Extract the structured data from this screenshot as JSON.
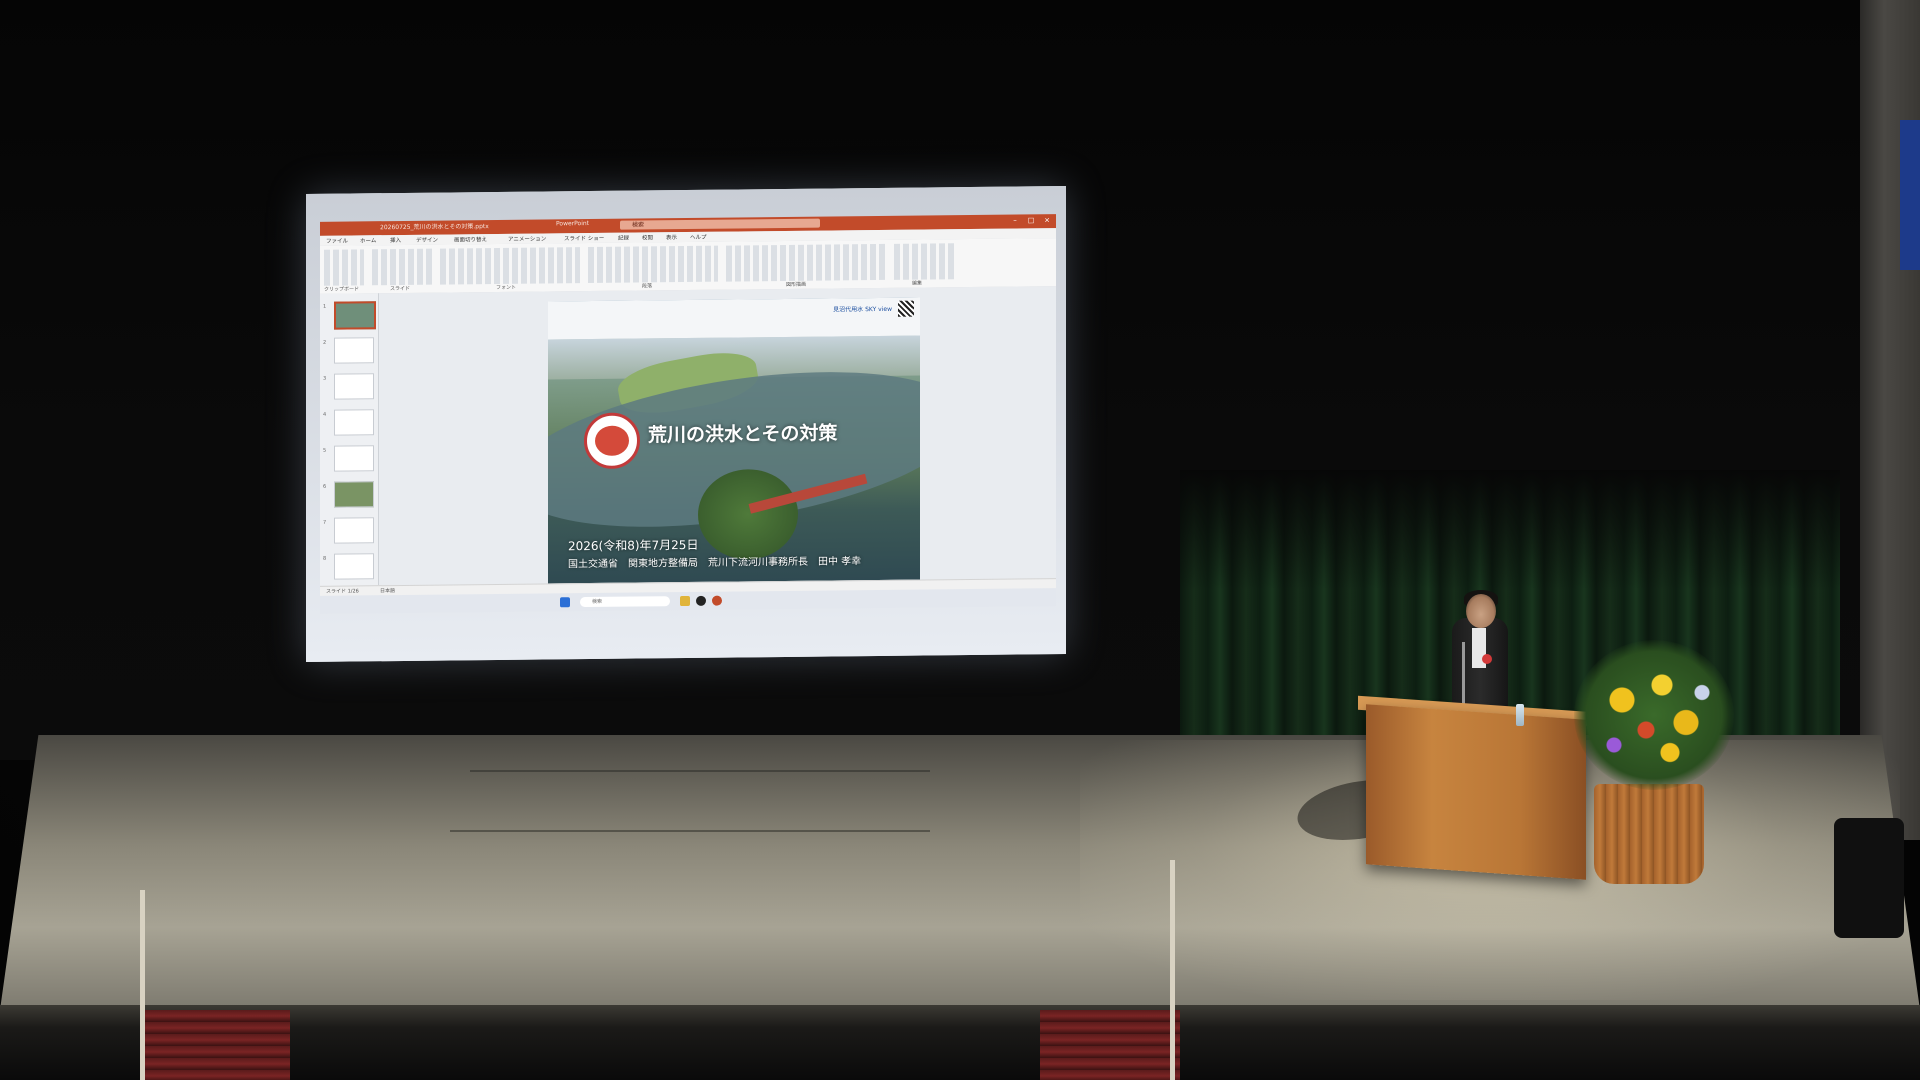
{
  "slide_topbar_text": "見沼代用水 SKY view",
  "slide_title": "荒川の洪水とその対策",
  "slide_date": "2026(令和8)年7月25日",
  "slide_author": "国土交通省　関東地方整備局　荒川下流河川事務所長　田中 孝幸",
  "ppt": {
    "window_title": "20260725_荒川の洪水とその対策.pptx",
    "app_name": "PowerPoint",
    "search_placeholder": "検索",
    "tabs": [
      "ファイル",
      "ホーム",
      "挿入",
      "デザイン",
      "画面切り替え",
      "アニメーション",
      "スライド ショー",
      "記録",
      "校閲",
      "表示",
      "ヘルプ"
    ],
    "ribbon_groups": [
      "クリップボード",
      "スライド",
      "フォント",
      "段落",
      "図形描画",
      "編集"
    ],
    "status_left": "スライド 1/26",
    "status_lang": "日本語",
    "taskbar_search": "検索"
  },
  "colors": {
    "ppt_accent": "#c24b2a",
    "stage_floor": "#a7a394",
    "podium": "#c7843f"
  }
}
